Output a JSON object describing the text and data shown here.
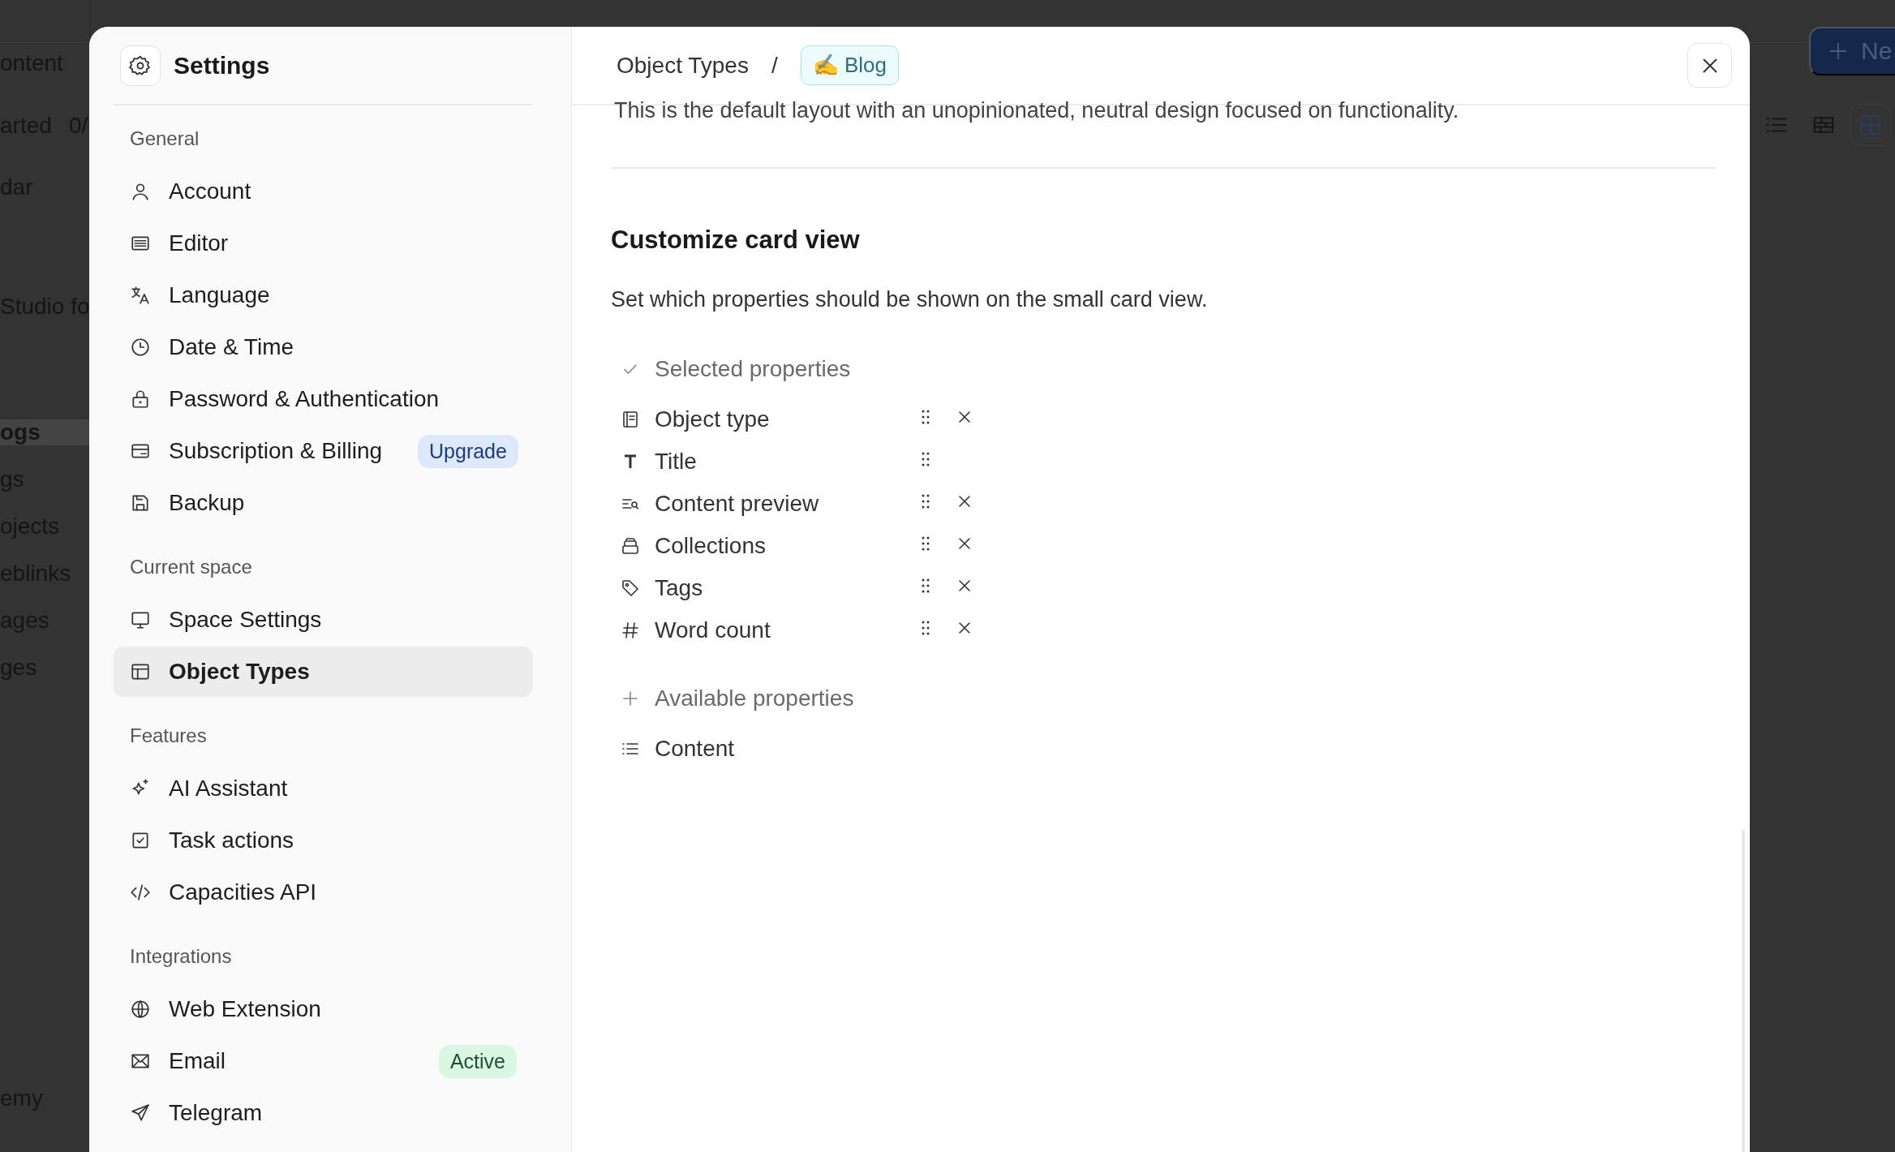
{
  "background": {
    "sidebar_items": [
      {
        "label": "ontent",
        "selected": false
      },
      {
        "label": "arted",
        "selected": false
      },
      {
        "label": "0/",
        "selected": false
      },
      {
        "label": "dar",
        "selected": false
      },
      {
        "label": "Studio fo",
        "selected": false
      },
      {
        "label": "ogs",
        "selected": true
      },
      {
        "label": "gs",
        "selected": false
      },
      {
        "label": "ojects",
        "selected": false
      },
      {
        "label": "eblinks",
        "selected": false
      },
      {
        "label": "ages",
        "selected": false
      },
      {
        "label": "ges",
        "selected": false
      },
      {
        "label": "emy",
        "selected": false
      }
    ],
    "new_button": {
      "label": "Ne"
    },
    "view_buttons": [
      {
        "kind": "list",
        "selected": false
      },
      {
        "kind": "table",
        "selected": false
      },
      {
        "kind": "grid",
        "selected": true
      }
    ]
  },
  "settings": {
    "title": "Settings",
    "sections": [
      {
        "heading": "General",
        "items": [
          {
            "label": "Account",
            "selected": false
          },
          {
            "label": "Editor",
            "selected": false
          },
          {
            "label": "Language",
            "selected": false
          },
          {
            "label": "Date & Time",
            "selected": false
          },
          {
            "label": "Password & Authentication",
            "selected": false
          },
          {
            "label": "Subscription & Billing",
            "selected": false,
            "badge": {
              "text": "Upgrade",
              "kind": "upgrade"
            }
          },
          {
            "label": "Backup",
            "selected": false
          }
        ]
      },
      {
        "heading": "Current space",
        "items": [
          {
            "label": "Space Settings",
            "selected": false
          },
          {
            "label": "Object Types",
            "selected": true
          }
        ]
      },
      {
        "heading": "Features",
        "items": [
          {
            "label": "AI Assistant",
            "selected": false
          },
          {
            "label": "Task actions",
            "selected": false
          },
          {
            "label": "Capacities API",
            "selected": false
          }
        ]
      },
      {
        "heading": "Integrations",
        "items": [
          {
            "label": "Web Extension",
            "selected": false
          },
          {
            "label": "Email",
            "selected": false,
            "badge": {
              "text": "Active",
              "kind": "active"
            }
          },
          {
            "label": "Telegram",
            "selected": false
          }
        ]
      }
    ]
  },
  "content": {
    "breadcrumb": {
      "parent": "Object Types",
      "separator": "/",
      "current": "✍ Blog"
    },
    "description": "This is the default layout with an unopinionated, neutral design focused on functionality.",
    "card_view": {
      "heading": "Customize card view",
      "text": "Set which properties should be shown on the small card view.",
      "selected_heading": "Selected properties",
      "selected": [
        {
          "label": "Object type",
          "removable": true
        },
        {
          "label": "Title",
          "removable": false
        },
        {
          "label": "Content preview",
          "removable": true
        },
        {
          "label": "Collections",
          "removable": true
        },
        {
          "label": "Tags",
          "removable": true
        },
        {
          "label": "Word count",
          "removable": true
        }
      ],
      "available_heading": "Available properties",
      "available": [
        {
          "label": "Content"
        }
      ]
    }
  }
}
